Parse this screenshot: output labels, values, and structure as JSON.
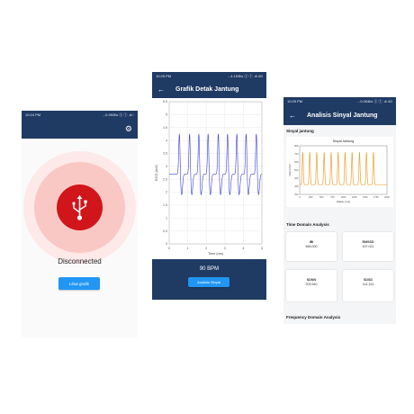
{
  "phone1": {
    "status_time": "10:24 PM",
    "status_right": "...0.2KB/s ⓢ ⓣ .ıll ◦",
    "status_text": "Disconnected",
    "button_label": "Lihat grafik"
  },
  "phone2": {
    "status_time": "10:25 PM",
    "status_right": "...4.1KB/s ⓢ ⓣ .ıll 4G",
    "title": "Grafik Detak Jantung",
    "ylabel": "ECG (mV)",
    "xlabel": "Time (ms)",
    "bpm_text": "90 BPM",
    "button_label": "Analisis Sinyal",
    "chart_data": {
      "type": "line",
      "title": "",
      "xlabel": "Time (ms)",
      "ylabel": "ECG (mV)",
      "xlim": [
        0,
        5
      ],
      "ylim": [
        0,
        5.5
      ],
      "x_ticks": [
        "0",
        "1",
        "2",
        "3",
        "4",
        "5"
      ],
      "y_ticks": [
        "0",
        "0.5",
        "1",
        "1.5",
        "2",
        "2.5",
        "3",
        "3.5",
        "4",
        "4.5",
        "5",
        "5.5"
      ],
      "peak_times": [
        0.55,
        1.1,
        1.6,
        2.1,
        2.65,
        3.15,
        3.65,
        4.15,
        4.7
      ],
      "peak_value": 4.3,
      "baseline_value": 2.7,
      "trough_value": 1.9
    }
  },
  "phone3": {
    "status_time": "10:25 PM",
    "status_right": "...0.0KB/s ⓢ ⓣ .ıll 4G",
    "title": "Analisis Sinyal Jantung",
    "section_signal": "Sinyal jantung",
    "chart_title": "Sinyal Jantung",
    "chart_ylabel": "Nilai (mV)",
    "chart_xlabel": "Waktu (ms)",
    "section_time": "Time Domain Analysis",
    "section_freq": "Frequency Domain Analysis",
    "metrics": [
      {
        "name": "IBI",
        "value": "666.000"
      },
      {
        "name": "RMSSD",
        "value": "157.021"
      },
      {
        "name": "SDNN",
        "value": "209.940"
      },
      {
        "name": "SDSD",
        "value": "114.151"
      }
    ],
    "chart_data": {
      "type": "line",
      "title": "Sinyal Jantung",
      "xlabel": "Waktu (ms)",
      "ylabel": "Nilai (mV)",
      "xlim": [
        0,
        2000
      ],
      "ylim": [
        200,
        800
      ],
      "x_ticks": [
        "0",
        "250",
        "500",
        "750",
        "1000",
        "1250",
        "1500",
        "1750",
        "2000"
      ],
      "y_ticks": [
        "200",
        "300",
        "400",
        "500",
        "600",
        "700",
        "800"
      ],
      "peak_times": [
        70,
        230,
        390,
        560,
        720,
        880,
        1040,
        1200,
        1370,
        1530,
        1690
      ],
      "peak_value": 720,
      "baseline_value": 320,
      "color": "#f0a030"
    }
  }
}
